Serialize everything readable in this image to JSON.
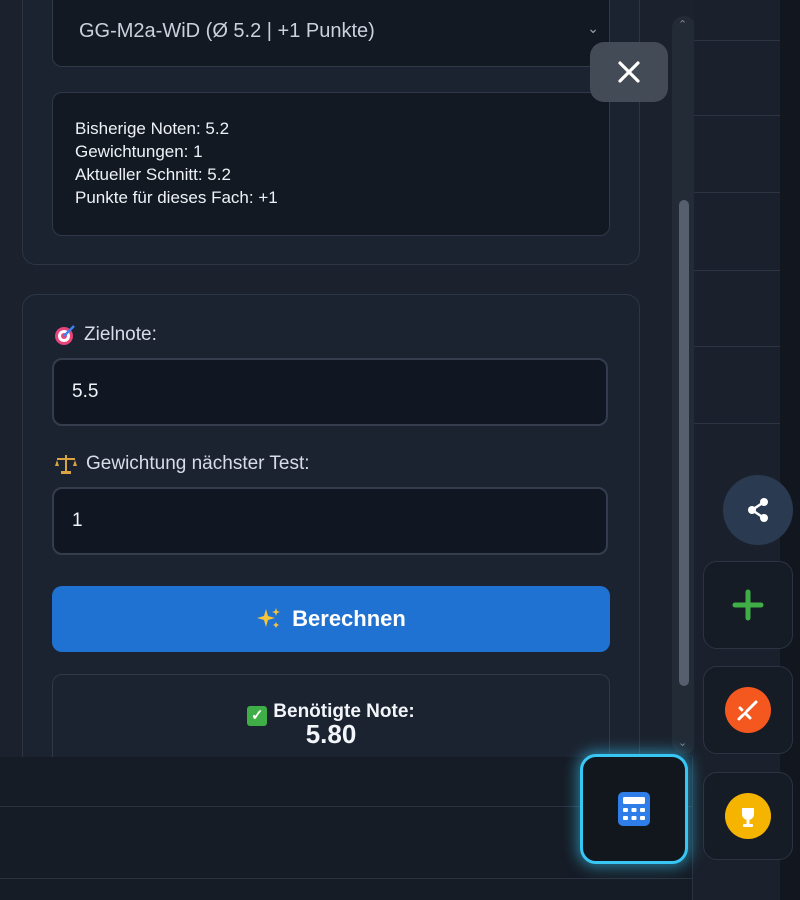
{
  "subject_select": {
    "value": "GG-M2a-WiD (Ø 5.2 | +1 Punkte)"
  },
  "info": {
    "line1": "Bisherige Noten: 5.2",
    "line2": "Gewichtungen: 1",
    "line3": "Aktueller Schnitt: 5.2",
    "line4": "Punkte für dieses Fach: +1"
  },
  "form": {
    "target_label": "Zielnote:",
    "target_value": "5.5",
    "weight_label": "Gewichtung nächster Test:",
    "weight_value": "1",
    "calc_button": "Berechnen"
  },
  "result": {
    "label": "Benötigte Note:",
    "value": "5.80"
  },
  "icons": {
    "target": "dart-target-icon",
    "scale": "balance-scale-icon",
    "sparkles": "sparkles-icon",
    "check": "check-mark-icon",
    "close": "close-icon",
    "share": "share-icon",
    "add": "plus-icon",
    "tool": "tool-icon",
    "trophy": "trophy-icon",
    "calculator": "calculator-icon"
  },
  "colors": {
    "primary_button": "#1f72d1",
    "highlight": "#38c6f4",
    "add_green": "#3fae46",
    "tool_orange": "#f5581f",
    "trophy_yellow": "#f5b400",
    "calculator_blue": "#2f7de8"
  }
}
